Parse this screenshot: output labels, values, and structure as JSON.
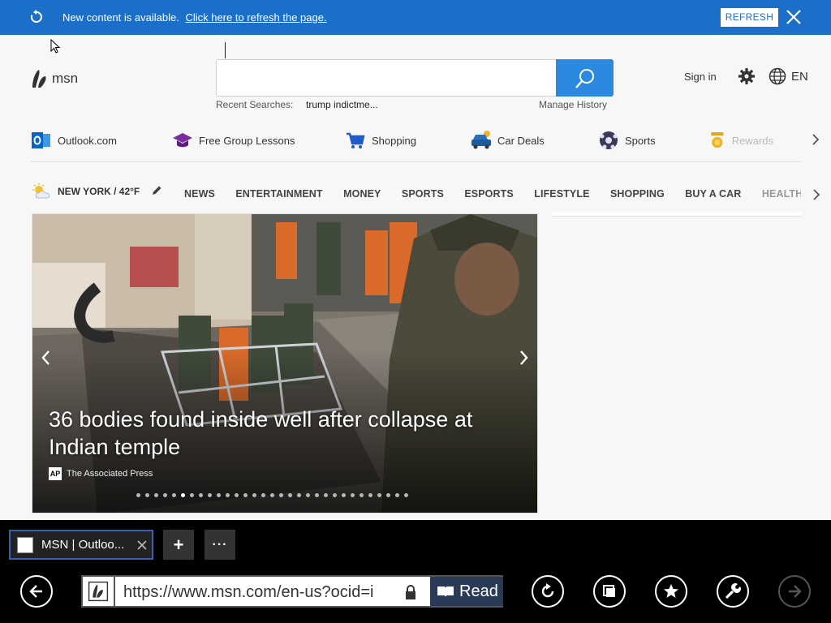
{
  "notification": {
    "message": "New content is available.",
    "link_text": "Click here to refresh the page.",
    "refresh_label": "REFRESH"
  },
  "header": {
    "logo_text": "msn",
    "search_placeholder": "",
    "recent_label": "Recent Searches:",
    "recent_item": "trump indictme...",
    "manage_history": "Manage History",
    "sign_in": "Sign in",
    "language": "EN"
  },
  "quick_links": [
    {
      "label": "Outlook.com",
      "icon": "outlook-icon"
    },
    {
      "label": "Free Group Lessons",
      "icon": "graduation-cap-icon"
    },
    {
      "label": "Shopping",
      "icon": "cart-icon"
    },
    {
      "label": "Car Deals",
      "icon": "car-icon"
    },
    {
      "label": "Sports",
      "icon": "soccer-ball-icon"
    },
    {
      "label": "Rewards",
      "icon": "medal-icon"
    }
  ],
  "weather": {
    "location": "NEW YORK / 42°F"
  },
  "nav": [
    "NEWS",
    "ENTERTAINMENT",
    "MONEY",
    "SPORTS",
    "ESPORTS",
    "LIFESTYLE",
    "SHOPPING",
    "BUY A CAR",
    "HEALTH"
  ],
  "hero": {
    "title": "36 bodies found inside well after collapse at Indian temple",
    "source_logo": "AP",
    "source": "The Associated Press",
    "slide_count": 31,
    "active_slide": 5
  },
  "browser": {
    "tab_title": "MSN | Outloo...",
    "new_tab": "+",
    "more_tabs": "···",
    "url": "https://www.msn.com/en-us?ocid=i",
    "read_label": "Read"
  },
  "colors": {
    "notify_bg": "#1b6fc8",
    "search_btn": "#2b8adf",
    "tab_border": "#3b5eb3"
  }
}
